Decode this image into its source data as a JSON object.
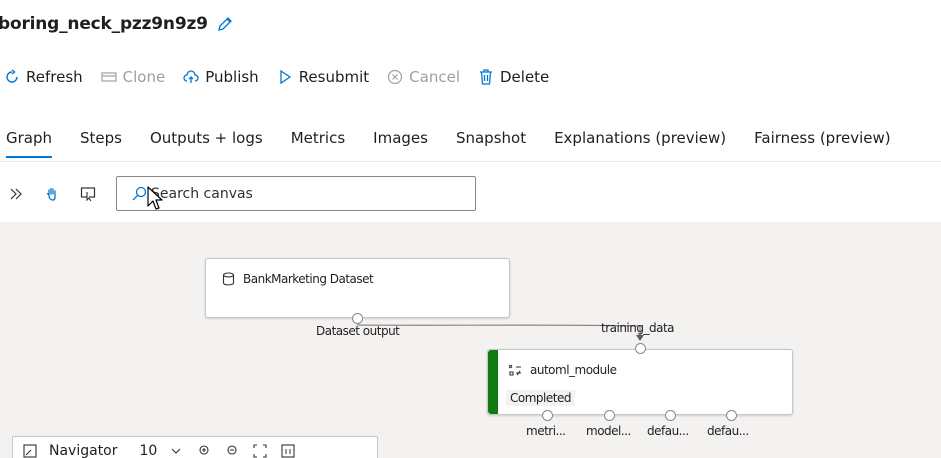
{
  "header": {
    "title": "boring_neck_pzz9n9z9"
  },
  "toolbar": {
    "refresh_label": "Refresh",
    "clone_label": "Clone",
    "publish_label": "Publish",
    "resubmit_label": "Resubmit",
    "cancel_label": "Cancel",
    "delete_label": "Delete"
  },
  "tabs": [
    {
      "label": "Graph",
      "active": true
    },
    {
      "label": "Steps"
    },
    {
      "label": "Outputs + logs"
    },
    {
      "label": "Metrics"
    },
    {
      "label": "Images"
    },
    {
      "label": "Snapshot"
    },
    {
      "label": "Explanations (preview)"
    },
    {
      "label": "Fairness (preview)"
    }
  ],
  "canvas_tools": {
    "search_placeholder": "Search canvas"
  },
  "nodes": {
    "dataset": {
      "title": "BankMarketing Dataset",
      "output_label": "Dataset output"
    },
    "automl": {
      "title": "automl_module",
      "input_label": "training_data",
      "status": "Completed",
      "outputs": [
        "metri...",
        "model...",
        "defau...",
        "defau..."
      ]
    }
  },
  "navigator": {
    "label": "Navigator",
    "zoom": "10"
  },
  "colors": {
    "accent": "#0078d4",
    "status_completed": "#107c10",
    "canvas_bg": "#f3f2f1"
  }
}
